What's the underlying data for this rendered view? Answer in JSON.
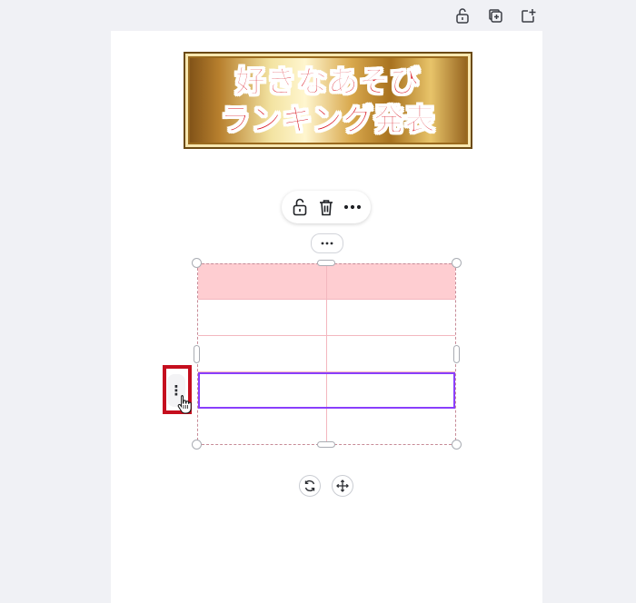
{
  "banner": {
    "line1": "好きなあそび",
    "line2": "ランキング発表"
  },
  "top_actions": {
    "icons": [
      "lock-open-icon",
      "duplicate-icon",
      "share-add-icon"
    ]
  },
  "element_toolbar": {
    "icons": [
      "lock-open-icon",
      "trash-icon",
      "more-icon"
    ]
  },
  "table": {
    "rows": 5,
    "columns": 2,
    "header_color": "#fecdd1",
    "border_color": "#f3b7bf",
    "selected_row_index": 3,
    "selected_color": "#8a3ffc"
  },
  "row_menu": {
    "label": "⋮",
    "highlight_color": "#c50e1e"
  },
  "bottom_controls": {
    "icons": [
      "rotate-icon",
      "move-icon"
    ]
  }
}
